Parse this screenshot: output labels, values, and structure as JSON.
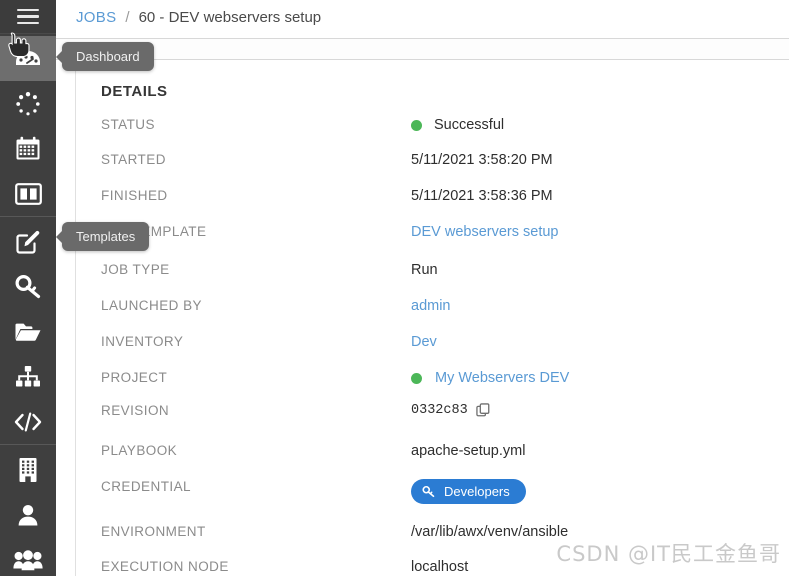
{
  "breadcrumb": {
    "root_label": "JOBS",
    "separator": "/",
    "current_label": "60 - DEV webservers setup"
  },
  "sidebar": {
    "hamburger_name": "menu-icon",
    "groups": [
      {
        "items": [
          {
            "label": "Dashboard",
            "icon": "dashboard-gauge-icon",
            "active": true
          },
          {
            "label": "Jobs",
            "icon": "jobs-spinner-icon",
            "active": false
          },
          {
            "label": "Schedules",
            "icon": "calendar-icon",
            "active": false
          },
          {
            "label": "My View",
            "icon": "portal-panels-icon",
            "active": false
          }
        ]
      },
      {
        "items": [
          {
            "label": "Templates",
            "icon": "pencil-square-icon",
            "active": false
          },
          {
            "label": "Credentials",
            "icon": "key-icon",
            "active": false
          },
          {
            "label": "Projects",
            "icon": "folder-open-icon",
            "active": false
          },
          {
            "label": "Inventories",
            "icon": "sitemap-icon",
            "active": false
          },
          {
            "label": "Inventory Scripts",
            "icon": "code-brackets-icon",
            "active": false
          }
        ]
      },
      {
        "items": [
          {
            "label": "Organizations",
            "icon": "building-icon",
            "active": false
          },
          {
            "label": "Users",
            "icon": "user-icon",
            "active": false
          },
          {
            "label": "Teams",
            "icon": "users-group-icon",
            "active": false
          }
        ]
      }
    ]
  },
  "tooltips": {
    "dashboard": "Dashboard",
    "templates": "Templates"
  },
  "details": {
    "title": "DETAILS",
    "rows": [
      {
        "label": "STATUS",
        "value": "Successful",
        "kind": "status",
        "dot_color": "#4cb758"
      },
      {
        "label": "STARTED",
        "value": "5/11/2021 3:58:20 PM",
        "kind": "text"
      },
      {
        "label": "FINISHED",
        "value": "5/11/2021 3:58:36 PM",
        "kind": "text"
      },
      {
        "label": "JOB TEMPLATE",
        "value": "DEV webservers setup",
        "kind": "link"
      },
      {
        "label": "JOB TYPE",
        "value": "Run",
        "kind": "text"
      },
      {
        "label": "LAUNCHED BY",
        "value": "admin",
        "kind": "link"
      },
      {
        "label": "INVENTORY",
        "value": "Dev",
        "kind": "link"
      },
      {
        "label": "PROJECT",
        "value": "My Webservers DEV",
        "kind": "project-link",
        "dot_color": "#4cb758"
      },
      {
        "label": "REVISION",
        "value": "0332c83",
        "kind": "revision",
        "copy_icon": "copy-icon"
      },
      {
        "label": "PLAYBOOK",
        "value": "apache-setup.yml",
        "kind": "text"
      },
      {
        "label": "CREDENTIAL",
        "value": "Developers",
        "kind": "badge",
        "badge_icon": "key-icon",
        "badge_color": "#2b7cd3"
      },
      {
        "label": "ENVIRONMENT",
        "value": "/var/lib/awx/venv/ansible",
        "kind": "text"
      },
      {
        "label": "EXECUTION NODE",
        "value": "localhost",
        "kind": "text"
      }
    ]
  },
  "watermark": {
    "text": "CSDN @IT民工金鱼哥"
  },
  "colors": {
    "sidebar_bg": "#3f3f3f",
    "sidebar_active": "#6e6e6e",
    "link": "#5a9ad4",
    "success": "#4cb758",
    "badge_blue": "#2b7cd3",
    "tooltip_bg": "#6a6a6a"
  }
}
